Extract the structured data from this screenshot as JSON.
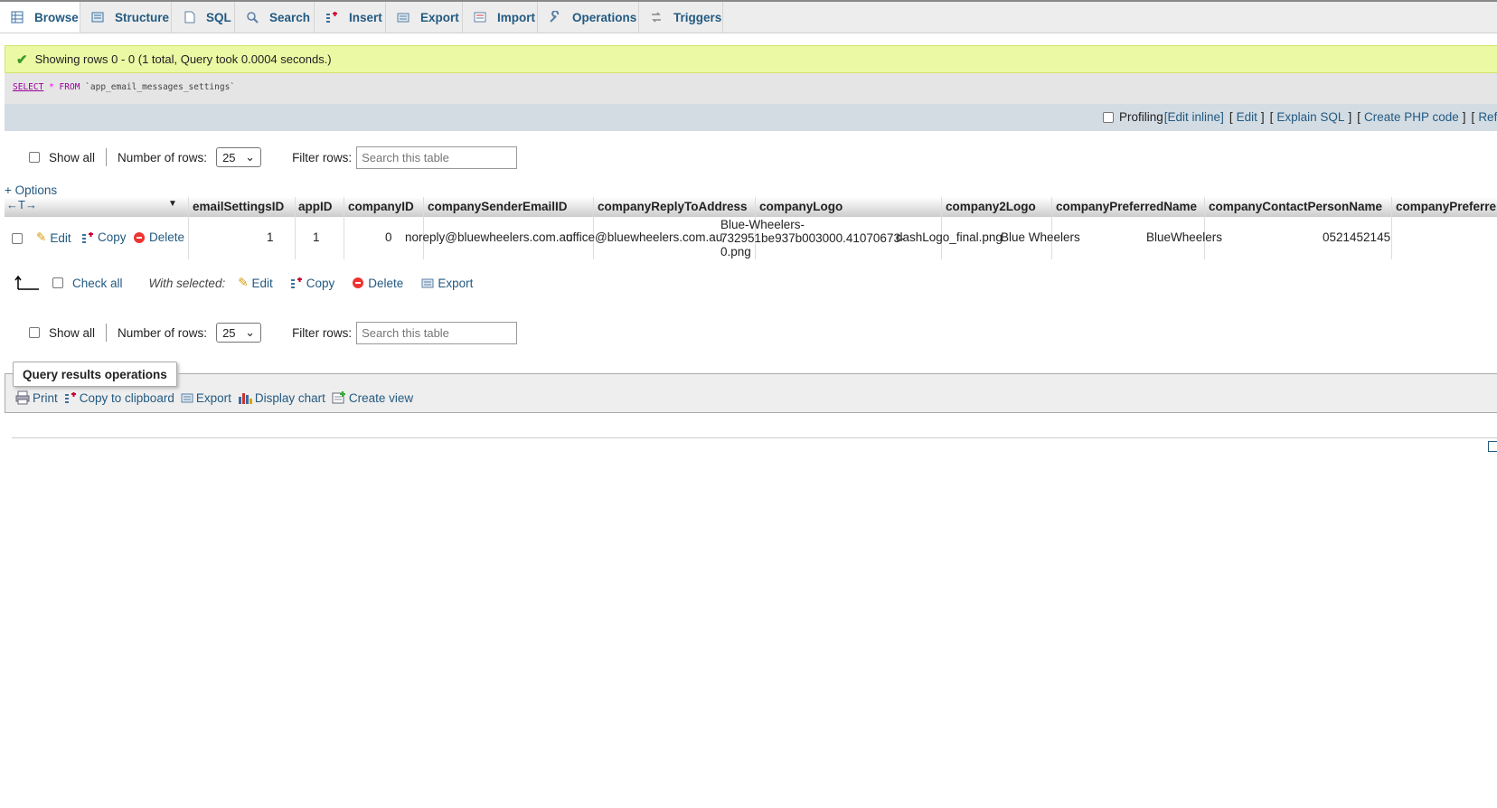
{
  "tabs": [
    {
      "label": "Browse",
      "icon": "browse-icon"
    },
    {
      "label": "Structure",
      "icon": "structure-icon"
    },
    {
      "label": "SQL",
      "icon": "sql-icon"
    },
    {
      "label": "Search",
      "icon": "search-icon"
    },
    {
      "label": "Insert",
      "icon": "insert-icon"
    },
    {
      "label": "Export",
      "icon": "export-icon"
    },
    {
      "label": "Import",
      "icon": "import-icon"
    },
    {
      "label": "Operations",
      "icon": "wrench-icon"
    },
    {
      "label": "Triggers",
      "icon": "triggers-icon"
    }
  ],
  "message": "Showing rows 0 - 0 (1 total, Query took 0.0004 seconds.)",
  "sql": {
    "select": "SELECT",
    "star": "*",
    "from": "FROM",
    "table": "`app_email_messages_settings`"
  },
  "profiling": {
    "label": "Profiling",
    "edit_inline": "[Edit inline]",
    "edit": "Edit",
    "explain": "Explain SQL",
    "create_php": "Create PHP code",
    "refresh": "Refres"
  },
  "nav": {
    "show_all": "Show all",
    "number_of_rows": "Number of rows:",
    "rows_value": "25",
    "filter_rows": "Filter rows:",
    "search_placeholder": "Search this table"
  },
  "options_link": "+ Options",
  "columns": [
    "emailSettingsID",
    "appID",
    "companyID",
    "companySenderEmailID",
    "companyReplyToAddress",
    "companyLogo",
    "company2Logo",
    "companyPreferredName",
    "companyContactPersonName",
    "companyPreferre"
  ],
  "row_actions": {
    "edit": "Edit",
    "copy": "Copy",
    "delete": "Delete"
  },
  "row": {
    "emailSettingsID": "1",
    "appID": "1",
    "companyID": "0",
    "companySenderEmailID": "noreply@bluewheelers.com.au",
    "companyReplyToAddress": "office@bluewheelers.com.au",
    "companyLogo_line1": "Blue-Wheelers-",
    "companyLogo_line2": "732951be937b003000.41070673-",
    "companyLogo_line3": "0.png",
    "company2Logo": "dashLogo_final.png",
    "companyPreferredName": "Blue Wheelers",
    "companyContactPersonName": "BlueWheelers",
    "companyPreferre": "0521452145"
  },
  "bulk": {
    "check_all": "Check all",
    "with_selected": "With selected:",
    "edit": "Edit",
    "copy": "Copy",
    "delete": "Delete",
    "export": "Export"
  },
  "qro": {
    "legend": "Query results operations",
    "print": "Print",
    "copy": "Copy to clipboard",
    "export": "Export",
    "chart": "Display chart",
    "view": "Create view"
  }
}
